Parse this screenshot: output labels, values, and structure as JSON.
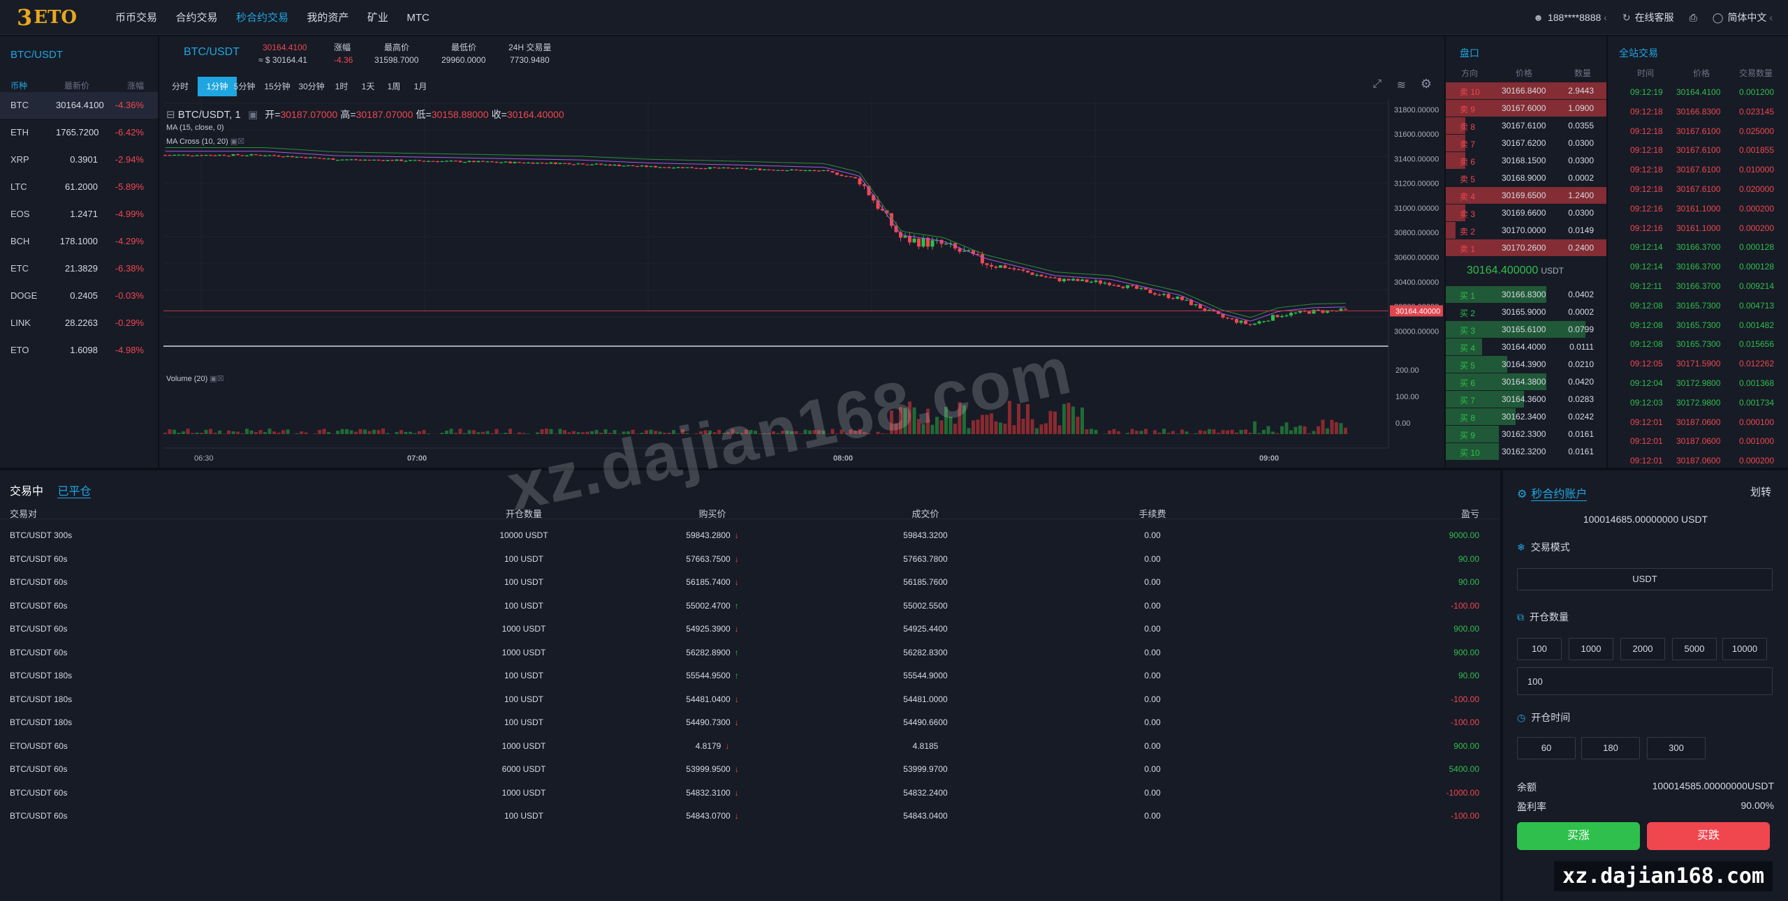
{
  "nav": {
    "logo_mark": "3",
    "logo_text": "ETO",
    "items": [
      "币币交易",
      "合约交易",
      "秒合约交易",
      "我的资产",
      "矿业",
      "MTC"
    ],
    "active_index": 2,
    "user": "188****8888",
    "support": "在线客服",
    "lang": "简体中文"
  },
  "coinlist": {
    "title": "BTC/USDT",
    "headers": [
      "币种",
      "最新价",
      "涨幅"
    ],
    "rows": [
      {
        "sym": "BTC",
        "price": "30164.4100",
        "chg": "-4.36%"
      },
      {
        "sym": "ETH",
        "price": "1765.7200",
        "chg": "-6.42%"
      },
      {
        "sym": "XRP",
        "price": "0.3901",
        "chg": "-2.94%"
      },
      {
        "sym": "LTC",
        "price": "61.2000",
        "chg": "-5.89%"
      },
      {
        "sym": "EOS",
        "price": "1.2471",
        "chg": "-4.99%"
      },
      {
        "sym": "BCH",
        "price": "178.1000",
        "chg": "-4.29%"
      },
      {
        "sym": "ETC",
        "price": "21.3829",
        "chg": "-6.38%"
      },
      {
        "sym": "DOGE",
        "price": "0.2405",
        "chg": "-0.03%"
      },
      {
        "sym": "LINK",
        "price": "28.2263",
        "chg": "-0.29%"
      },
      {
        "sym": "ETO",
        "price": "1.6098",
        "chg": "-4.98%"
      }
    ]
  },
  "ticker": {
    "pair": "BTC/USDT",
    "last": "30164.4100",
    "last_usd": "≈ $ 30164.41",
    "chg_label": "涨幅",
    "chg": "-4.36",
    "high_label": "最高价",
    "high": "31598.7000",
    "low_label": "最低价",
    "low": "29960.0000",
    "vol_label": "24H 交易量",
    "vol": "7730.9480"
  },
  "timeframes": [
    "分时",
    "1分钟",
    "5分钟",
    "15分钟",
    "30分钟",
    "1时",
    "1天",
    "1周",
    "1月"
  ],
  "active_tf": 1,
  "chart": {
    "legend_pair": "BTC/USDT, 1",
    "open_label": "开=",
    "open": "30187.07000",
    "high_label": "高=",
    "high": "30187.07000",
    "low_label": "低=",
    "low": "30158.88000",
    "close_label": "收=",
    "close": "30164.40000",
    "ma": "MA (15, close, 0)",
    "macross": "MA Cross (10, 20)",
    "volume": "Volume (20)",
    "price_ticks": [
      "31800.00000",
      "31600.00000",
      "31400.00000",
      "31200.00000",
      "31000.00000",
      "30800.00000",
      "30600.00000",
      "30400.00000",
      "30200.00000",
      "30000.00000"
    ],
    "last_tag": "30164.40000",
    "vol_ticks": [
      "200.00",
      "100.00",
      "0.00"
    ],
    "time_ticks": [
      "06:30",
      "07:00",
      "08:00",
      "09:00"
    ]
  },
  "orderbook": {
    "title": "盘口",
    "headers": [
      "方向",
      "价格",
      "数量"
    ],
    "asks": [
      {
        "d": "卖 10",
        "p": "30166.8400",
        "q": "2.9443",
        "w": 1.0
      },
      {
        "d": "卖 9",
        "p": "30167.6000",
        "q": "1.0900",
        "w": 1.0
      },
      {
        "d": "卖 8",
        "p": "30167.6100",
        "q": "0.0355",
        "w": 0.12
      },
      {
        "d": "卖 7",
        "p": "30167.6200",
        "q": "0.0300",
        "w": 0.12
      },
      {
        "d": "卖 6",
        "p": "30168.1500",
        "q": "0.0300",
        "w": 0.12
      },
      {
        "d": "卖 5",
        "p": "30168.9000",
        "q": "0.0002",
        "w": 0.0
      },
      {
        "d": "卖 4",
        "p": "30169.6500",
        "q": "1.2400",
        "w": 1.0
      },
      {
        "d": "卖 3",
        "p": "30169.6600",
        "q": "0.0300",
        "w": 0.12
      },
      {
        "d": "卖 2",
        "p": "30170.0000",
        "q": "0.0149",
        "w": 0.06
      },
      {
        "d": "卖 1",
        "p": "30170.2600",
        "q": "0.2400",
        "w": 1.0
      }
    ],
    "mid": "30164.400000",
    "mid_unit": "USDT",
    "bids": [
      {
        "d": "买 1",
        "p": "30166.8300",
        "q": "0.0402",
        "w": 0.72
      },
      {
        "d": "买 2",
        "p": "30165.9000",
        "q": "0.0002",
        "w": 0.0
      },
      {
        "d": "买 3",
        "p": "30165.6100",
        "q": "0.0799",
        "w": 1.0
      },
      {
        "d": "买 4",
        "p": "30164.4000",
        "q": "0.0111",
        "w": 0.26
      },
      {
        "d": "买 5",
        "p": "30164.3900",
        "q": "0.0210",
        "w": 0.44
      },
      {
        "d": "买 6",
        "p": "30164.3800",
        "q": "0.0420",
        "w": 0.72
      },
      {
        "d": "买 7",
        "p": "30164.3600",
        "q": "0.0283",
        "w": 0.56
      },
      {
        "d": "买 8",
        "p": "30162.3400",
        "q": "0.0242",
        "w": 0.5
      },
      {
        "d": "买 9",
        "p": "30162.3300",
        "q": "0.0161",
        "w": 0.38
      },
      {
        "d": "买 10",
        "p": "30162.3200",
        "q": "0.0161",
        "w": 0.38
      }
    ]
  },
  "trades": {
    "title": "全站交易",
    "headers": [
      "时间",
      "价格",
      "交易数量"
    ],
    "rows": [
      {
        "t": "09:12:19",
        "p": "30164.4100",
        "q": "0.001200",
        "s": "b"
      },
      {
        "t": "09:12:18",
        "p": "30166.8300",
        "q": "0.023145",
        "s": "s"
      },
      {
        "t": "09:12:18",
        "p": "30167.6100",
        "q": "0.025000",
        "s": "s"
      },
      {
        "t": "09:12:18",
        "p": "30167.6100",
        "q": "0.001855",
        "s": "s"
      },
      {
        "t": "09:12:18",
        "p": "30167.6100",
        "q": "0.010000",
        "s": "s"
      },
      {
        "t": "09:12:18",
        "p": "30167.6100",
        "q": "0.020000",
        "s": "s"
      },
      {
        "t": "09:12:16",
        "p": "30161.1000",
        "q": "0.000200",
        "s": "s"
      },
      {
        "t": "09:12:16",
        "p": "30161.1000",
        "q": "0.000200",
        "s": "s"
      },
      {
        "t": "09:12:14",
        "p": "30166.3700",
        "q": "0.000128",
        "s": "b"
      },
      {
        "t": "09:12:14",
        "p": "30166.3700",
        "q": "0.000128",
        "s": "b"
      },
      {
        "t": "09:12:11",
        "p": "30166.3700",
        "q": "0.009214",
        "s": "b"
      },
      {
        "t": "09:12:08",
        "p": "30165.7300",
        "q": "0.004713",
        "s": "b"
      },
      {
        "t": "09:12:08",
        "p": "30165.7300",
        "q": "0.001482",
        "s": "b"
      },
      {
        "t": "09:12:08",
        "p": "30165.7300",
        "q": "0.015656",
        "s": "b"
      },
      {
        "t": "09:12:05",
        "p": "30171.5900",
        "q": "0.012262",
        "s": "s"
      },
      {
        "t": "09:12:04",
        "p": "30172.9800",
        "q": "0.001368",
        "s": "b"
      },
      {
        "t": "09:12:03",
        "p": "30172.9800",
        "q": "0.001734",
        "s": "b"
      },
      {
        "t": "09:12:01",
        "p": "30187.0600",
        "q": "0.000100",
        "s": "s"
      },
      {
        "t": "09:12:01",
        "p": "30187.0600",
        "q": "0.001000",
        "s": "s"
      },
      {
        "t": "09:12:01",
        "p": "30187.0600",
        "q": "0.000200",
        "s": "s"
      }
    ]
  },
  "positions": {
    "tab_active": "交易中",
    "tab_other": "已平仓",
    "headers": [
      "交易对",
      "开仓数量",
      "购买价",
      "成交价",
      "手续费",
      "盈亏"
    ],
    "rows": [
      {
        "pair": "BTC/USDT 300s",
        "qty": "10000 USDT",
        "buy": "59843.2800",
        "dir": "down",
        "deal": "59843.3200",
        "fee": "0.00",
        "pnl": "9000.00",
        "pos": true
      },
      {
        "pair": "BTC/USDT 60s",
        "qty": "100 USDT",
        "buy": "57663.7500",
        "dir": "down",
        "deal": "57663.7800",
        "fee": "0.00",
        "pnl": "90.00",
        "pos": true
      },
      {
        "pair": "BTC/USDT 60s",
        "qty": "100 USDT",
        "buy": "56185.7400",
        "dir": "down",
        "deal": "56185.7600",
        "fee": "0.00",
        "pnl": "90.00",
        "pos": true
      },
      {
        "pair": "BTC/USDT 60s",
        "qty": "100 USDT",
        "buy": "55002.4700",
        "dir": "up",
        "deal": "55002.5500",
        "fee": "0.00",
        "pnl": "-100.00",
        "pos": false
      },
      {
        "pair": "BTC/USDT 60s",
        "qty": "1000 USDT",
        "buy": "54925.3900",
        "dir": "down",
        "deal": "54925.4400",
        "fee": "0.00",
        "pnl": "900.00",
        "pos": true
      },
      {
        "pair": "BTC/USDT 60s",
        "qty": "1000 USDT",
        "buy": "56282.8900",
        "dir": "up",
        "deal": "56282.8300",
        "fee": "0.00",
        "pnl": "900.00",
        "pos": true
      },
      {
        "pair": "BTC/USDT 180s",
        "qty": "100 USDT",
        "buy": "55544.9500",
        "dir": "up",
        "deal": "55544.9000",
        "fee": "0.00",
        "pnl": "90.00",
        "pos": true
      },
      {
        "pair": "BTC/USDT 180s",
        "qty": "100 USDT",
        "buy": "54481.0400",
        "dir": "down",
        "deal": "54481.0000",
        "fee": "0.00",
        "pnl": "-100.00",
        "pos": false
      },
      {
        "pair": "BTC/USDT 180s",
        "qty": "100 USDT",
        "buy": "54490.7300",
        "dir": "down",
        "deal": "54490.6600",
        "fee": "0.00",
        "pnl": "-100.00",
        "pos": false
      },
      {
        "pair": "ETO/USDT 60s",
        "qty": "1000 USDT",
        "buy": "4.8179",
        "dir": "down",
        "deal": "4.8185",
        "fee": "0.00",
        "pnl": "900.00",
        "pos": true
      },
      {
        "pair": "BTC/USDT 60s",
        "qty": "6000 USDT",
        "buy": "53999.9500",
        "dir": "down",
        "deal": "53999.9700",
        "fee": "0.00",
        "pnl": "5400.00",
        "pos": true
      },
      {
        "pair": "BTC/USDT 60s",
        "qty": "1000 USDT",
        "buy": "54832.3100",
        "dir": "down",
        "deal": "54832.2400",
        "fee": "0.00",
        "pnl": "-1000.00",
        "pos": false
      },
      {
        "pair": "BTC/USDT 60s",
        "qty": "100 USDT",
        "buy": "54843.0700",
        "dir": "down",
        "deal": "54843.0400",
        "fee": "0.00",
        "pnl": "-100.00",
        "pos": false
      }
    ]
  },
  "account": {
    "title": "秒合约账户",
    "transfer": "划转",
    "balance": "100014685.00000000 USDT",
    "mode_label": "交易模式",
    "mode_value": "USDT",
    "qty_label": "开仓数量",
    "qty_options": [
      "100",
      "1000",
      "2000",
      "5000",
      "10000"
    ],
    "qty_value": "100",
    "time_label": "开仓时间",
    "time_options": [
      "60",
      "180",
      "300"
    ],
    "avail_label": "余额",
    "avail_value": "100014585.00000000USDT",
    "rate_label": "盈利率",
    "rate_value": "90.00%",
    "buy_up": "买涨",
    "buy_down": "买跌"
  },
  "watermark": {
    "center": "xz.dajian168.com",
    "corner": "xz.dajian168.com"
  }
}
